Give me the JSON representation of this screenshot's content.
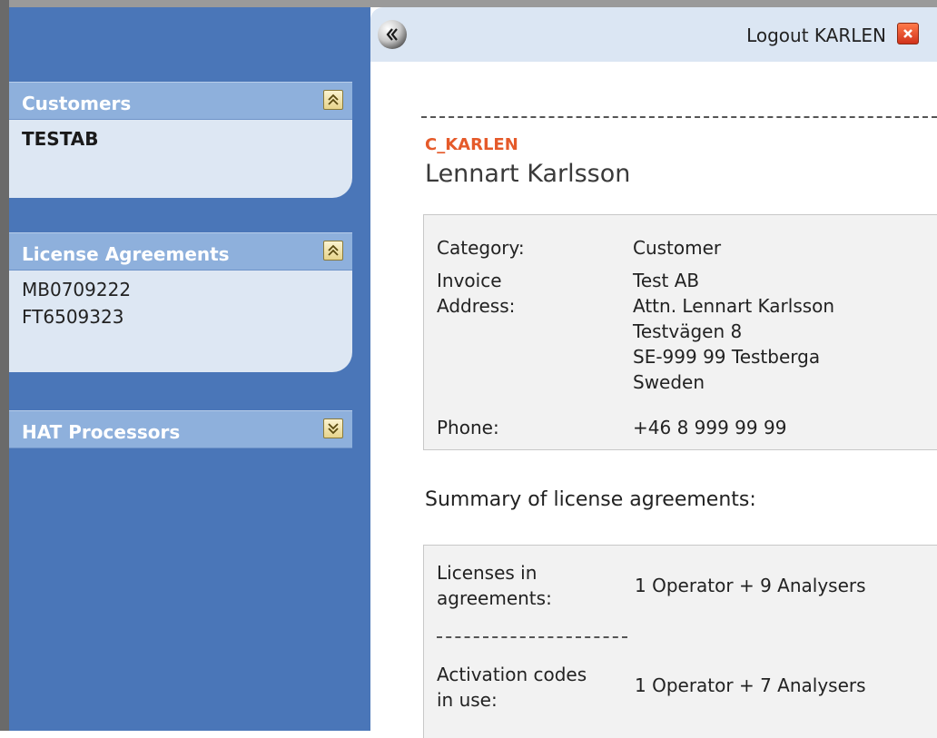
{
  "header": {
    "logout_label": "Logout KARLEN"
  },
  "sidebar": {
    "panels": [
      {
        "title": "Customers",
        "items": [
          "TESTAB"
        ]
      },
      {
        "title": "License Agreements",
        "items": [
          "MB0709222",
          "FT6509323"
        ]
      },
      {
        "title": "HAT Processors",
        "items": []
      }
    ]
  },
  "user": {
    "id": "C_KARLEN",
    "name": "Lennart Karlsson"
  },
  "details": {
    "category_label": "Category:",
    "category_value": "Customer",
    "invoice_label_line1": "Invoice",
    "invoice_label_line2": "Address:",
    "address_lines": [
      "Test AB",
      "Attn. Lennart Karlsson",
      "Testvägen 8",
      "SE-999 99 Testberga",
      "Sweden"
    ],
    "phone_label": "Phone:",
    "phone_value": "+46 8 999 99 99"
  },
  "summary": {
    "heading": "Summary of license agreements:",
    "licenses_label_line1": "Licenses in",
    "licenses_label_line2": "agreements:",
    "licenses_value": "1 Operator + 9 Analysers",
    "activation_label_line1": "Activation codes",
    "activation_label_line2": "in use:",
    "activation_value": "1 Operator + 7 Analysers"
  },
  "colors": {
    "sidebar_bg": "#4a76b8",
    "panel_header": "#8eb0dc",
    "panel_body": "#dde7f3",
    "accent": "#e55a2a"
  }
}
